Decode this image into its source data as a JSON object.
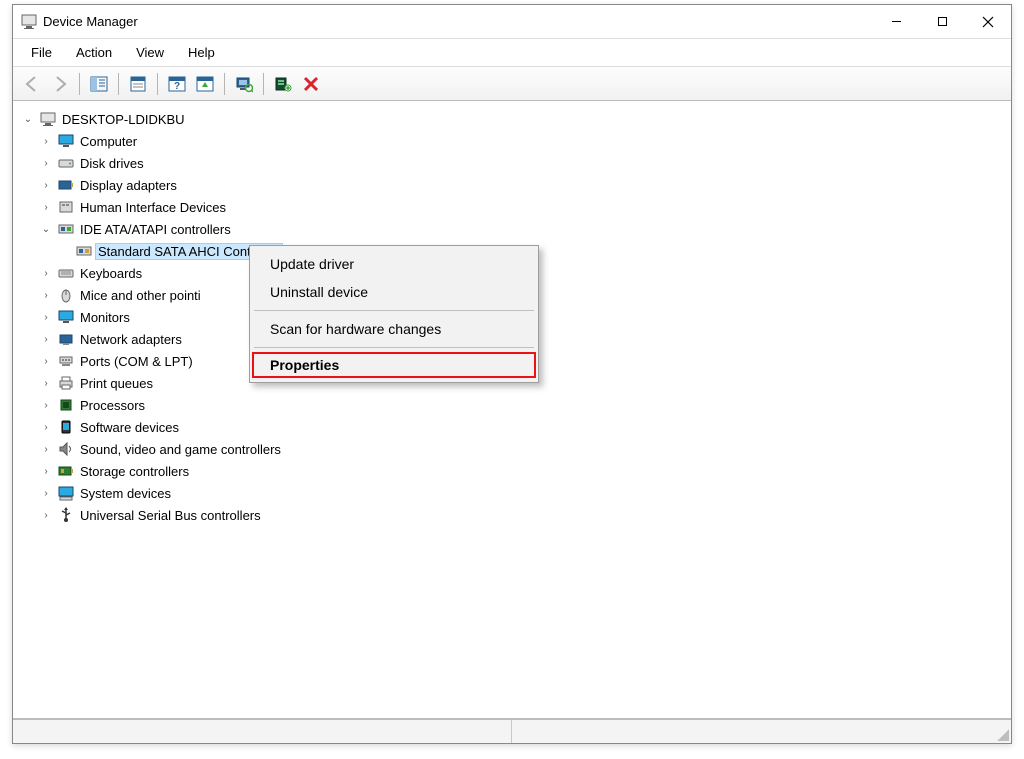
{
  "window": {
    "title": "Device Manager"
  },
  "menu": {
    "file": "File",
    "action": "Action",
    "view": "View",
    "help": "Help"
  },
  "toolbar": {
    "back": "Back",
    "forward": "Forward",
    "show_hide_tree": "Show/Hide Console Tree",
    "properties": "Properties",
    "help": "Help",
    "update": "Update Settings",
    "scan": "Scan for hardware changes",
    "add_legacy": "Add legacy hardware",
    "uninstall": "Uninstall device"
  },
  "tree": {
    "root": "DESKTOP-LDIDKBU",
    "items": {
      "computer": "Computer",
      "disk_drives": "Disk drives",
      "display_adapters": "Display adapters",
      "hid": "Human Interface Devices",
      "ide": "IDE ATA/ATAPI controllers",
      "ide_child": "Standard SATA AHCI Controller",
      "keyboards": "Keyboards",
      "mice": "Mice and other pointi",
      "monitors": "Monitors",
      "network": "Network adapters",
      "ports": "Ports (COM & LPT)",
      "print_queues": "Print queues",
      "processors": "Processors",
      "software_devices": "Software devices",
      "sound": "Sound, video and game controllers",
      "storage_controllers": "Storage controllers",
      "system_devices": "System devices",
      "usb": "Universal Serial Bus controllers"
    }
  },
  "context_menu": {
    "update_driver": "Update driver",
    "uninstall_device": "Uninstall device",
    "scan_changes": "Scan for hardware changes",
    "properties": "Properties"
  }
}
